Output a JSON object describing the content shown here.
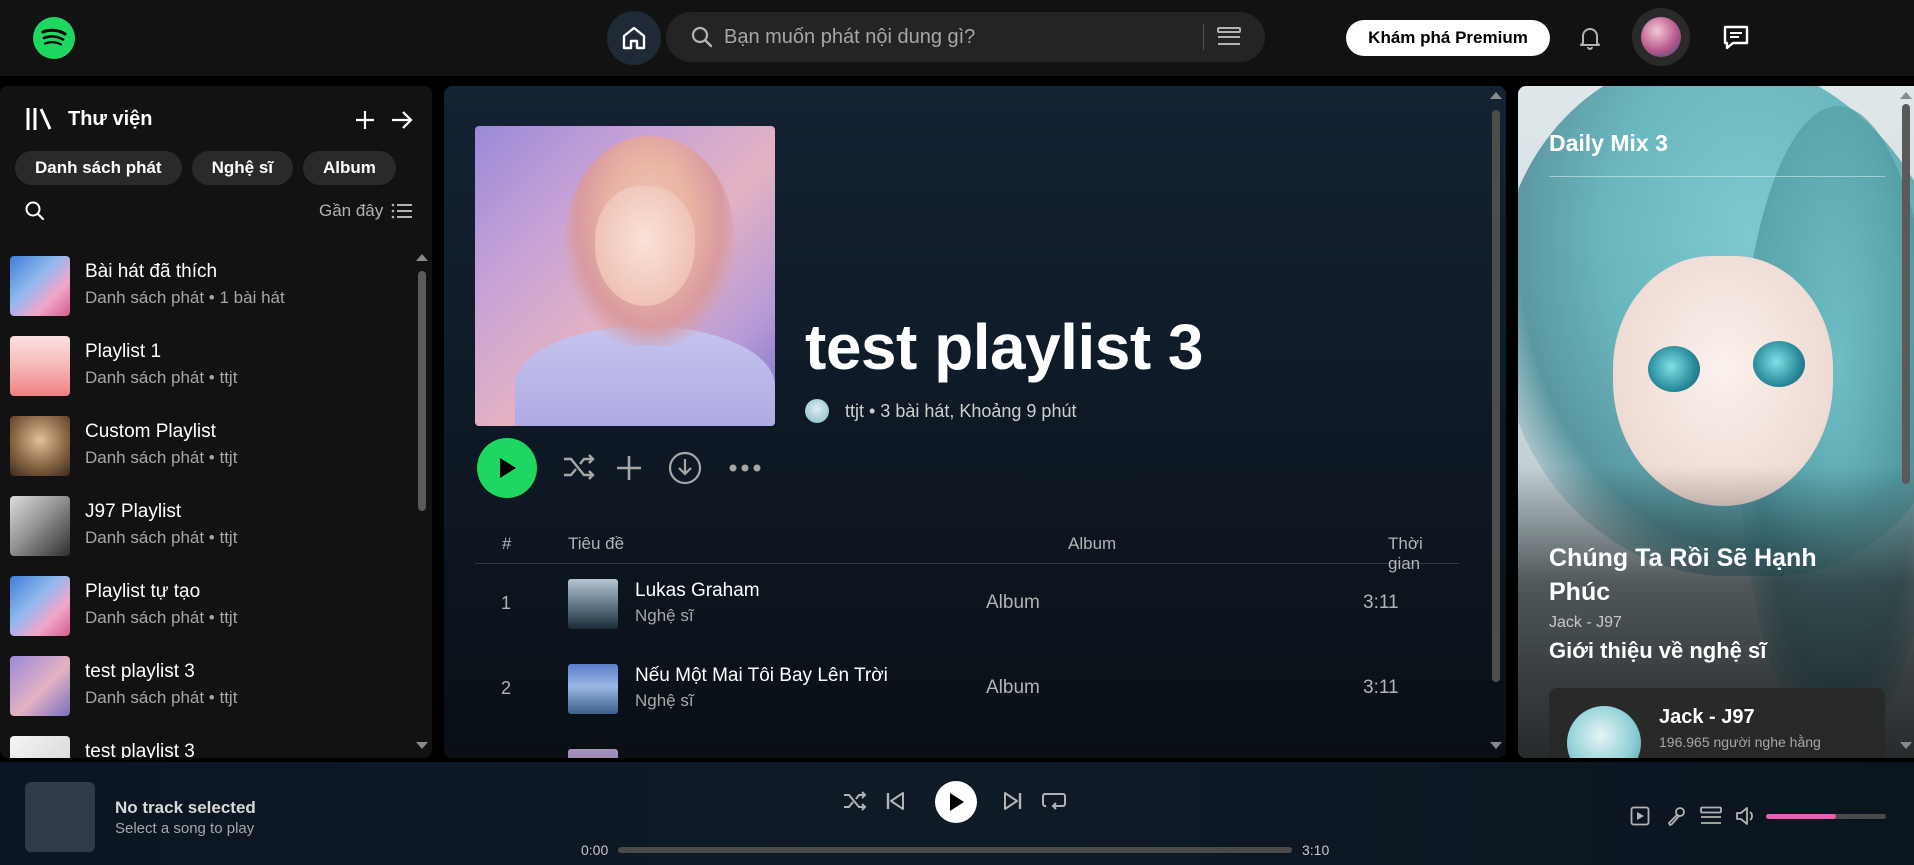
{
  "search": {
    "placeholder": "Bạn muốn phát nội dung gì?"
  },
  "header": {
    "premium_label": "Khám phá Premium"
  },
  "library": {
    "title": "Thư viện",
    "chips": [
      "Danh sách phát",
      "Nghệ sĩ",
      "Album"
    ],
    "sort_label": "Gần đây",
    "items": [
      {
        "name": "Bài hát đã thích",
        "sub": "Danh sách phát • 1 bài hát"
      },
      {
        "name": "Playlist 1",
        "sub": "Danh sách phát • ttjt"
      },
      {
        "name": "Custom Playlist",
        "sub": "Danh sách phát • ttjt"
      },
      {
        "name": "J97 Playlist",
        "sub": "Danh sách phát • ttjt"
      },
      {
        "name": "Playlist tự tạo",
        "sub": "Danh sách phát • ttjt"
      },
      {
        "name": "test playlist 3",
        "sub": "Danh sách phát • ttjt"
      },
      {
        "name": "test playlist 3",
        "sub": ""
      }
    ]
  },
  "playlist": {
    "title": "test playlist 3",
    "meta": "ttjt • 3 bài hát, Khoảng 9 phút",
    "columns": {
      "num": "#",
      "title": "Tiêu đề",
      "album": "Album",
      "duration": "Thời gian"
    },
    "tracks": [
      {
        "num": "1",
        "title": "Lukas Graham",
        "artist": "Nghệ sĩ",
        "album": "Album",
        "duration": "3:11"
      },
      {
        "num": "2",
        "title": "Nếu Một Mai Tôi Bay Lên Trời",
        "artist": "Nghệ sĩ",
        "album": "Album",
        "duration": "3:11"
      }
    ]
  },
  "right_panel": {
    "title": "Daily Mix 3",
    "song": "Chúng Ta Rồi Sẽ Hạnh Phúc",
    "artist": "Jack - J97",
    "intro": "Giới thiệu về nghệ sĩ",
    "card_name": "Jack - J97",
    "card_listeners": "196.965 người nghe hằng"
  },
  "player": {
    "title": "No track selected",
    "subtitle": "Select a song to play",
    "time_current": "0:00",
    "time_total": "3:10",
    "progress": 0,
    "volume": 0.58
  },
  "colors": {
    "accent": "#1ed760",
    "volume": "#e95fb3"
  },
  "icons": {
    "logo": "spotify-logo-icon",
    "home": "home-icon",
    "search": "search-icon",
    "browse": "browse-icon",
    "bell": "bell-icon",
    "chat": "chat-icon",
    "library": "library-icon",
    "plus": "plus-icon",
    "arrow": "arrow-right-icon",
    "list": "list-icon",
    "shuffle": "shuffle-icon",
    "download": "download-icon",
    "more": "more-icon",
    "prev": "previous-icon",
    "next": "next-icon",
    "repeat": "repeat-icon",
    "play": "play-icon",
    "now_playing_view": "now-playing-view-icon",
    "mic": "lyrics-icon",
    "queue": "queue-icon",
    "volume": "volume-icon"
  }
}
